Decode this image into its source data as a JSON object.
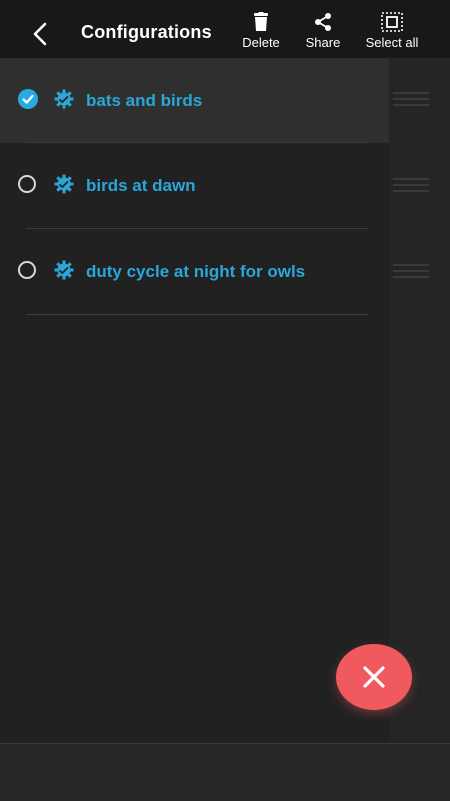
{
  "header": {
    "title": "Configurations",
    "actions": {
      "delete": "Delete",
      "share": "Share",
      "select_all": "Select all"
    }
  },
  "configurations": [
    {
      "name": "bats and birds",
      "selected": true
    },
    {
      "name": "birds at dawn",
      "selected": false
    },
    {
      "name": "duty cycle at night for owls",
      "selected": false
    }
  ],
  "colors": {
    "background": "#212121",
    "header": "#181818",
    "accent": "#29abe2",
    "item_text": "#2aa7d8",
    "fab": "#f05a5f"
  },
  "icons": {
    "back": "chevron-left-icon",
    "delete": "trash-icon",
    "share": "share-icon",
    "select_all": "select-all-icon",
    "config": "gear-icon",
    "checked": "check-icon",
    "drag": "drag-handle-icon",
    "fab": "close-icon"
  }
}
